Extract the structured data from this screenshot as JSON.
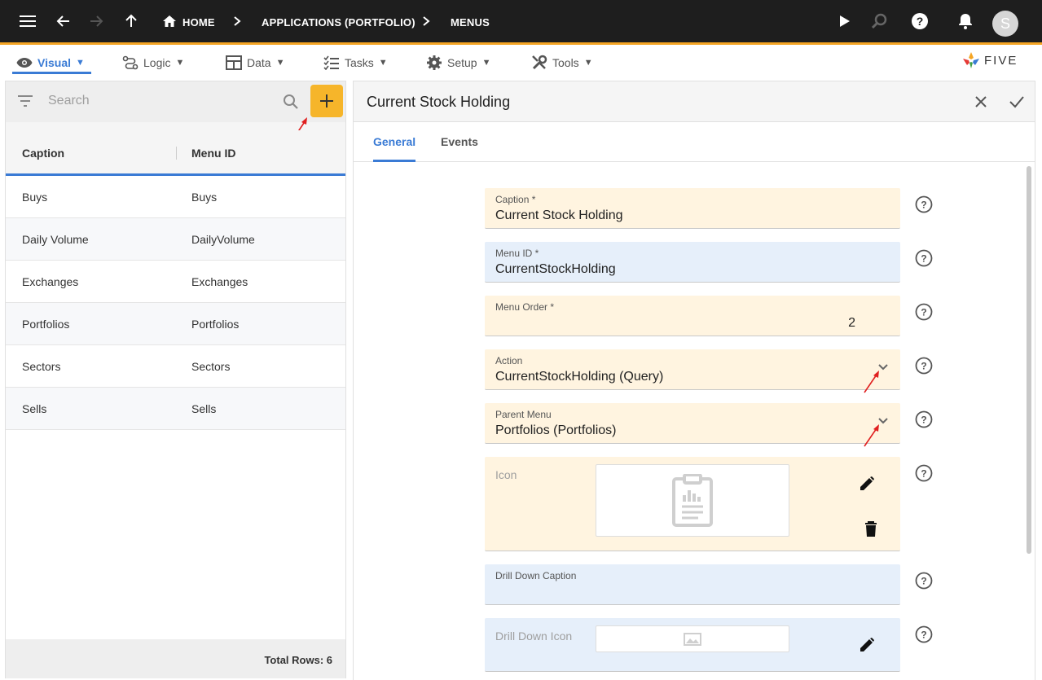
{
  "topbar": {
    "home": "HOME",
    "breadcrumb_app": "APPLICATIONS (PORTFOLIO)",
    "breadcrumb_menus": "MENUS",
    "avatar_letter": "S",
    "colors": {
      "bar": "#1e1e1e",
      "accent": "#f5a524"
    }
  },
  "menus": [
    {
      "label": "Visual",
      "icon": "eye-icon"
    },
    {
      "label": "Logic",
      "icon": "logic-icon"
    },
    {
      "label": "Data",
      "icon": "table-icon"
    },
    {
      "label": "Tasks",
      "icon": "tasks-icon"
    },
    {
      "label": "Setup",
      "icon": "gear-icon"
    },
    {
      "label": "Tools",
      "icon": "tools-icon"
    }
  ],
  "logo_text": "FIVE",
  "left": {
    "search_placeholder": "Search",
    "columns": [
      "Caption",
      "Menu ID"
    ],
    "rows": [
      {
        "caption": "Buys",
        "menu_id": "Buys"
      },
      {
        "caption": "Daily Volume",
        "menu_id": "DailyVolume"
      },
      {
        "caption": "Exchanges",
        "menu_id": "Exchanges"
      },
      {
        "caption": "Portfolios",
        "menu_id": "Portfolios"
      },
      {
        "caption": "Sectors",
        "menu_id": "Sectors"
      },
      {
        "caption": "Sells",
        "menu_id": "Sells"
      }
    ],
    "total_rows": "Total Rows: 6"
  },
  "form": {
    "title": "Current Stock Holding",
    "tabs": [
      "General",
      "Events"
    ],
    "caption": {
      "label": "Caption *",
      "value": "Current Stock Holding"
    },
    "menu_id": {
      "label": "Menu ID *",
      "value": "CurrentStockHolding"
    },
    "menu_order": {
      "label": "Menu Order *",
      "value": "2"
    },
    "action": {
      "label": "Action",
      "value": "CurrentStockHolding (Query)"
    },
    "parent_menu": {
      "label": "Parent Menu",
      "value": "Portfolios (Portfolios)"
    },
    "icon": {
      "label": "Icon"
    },
    "drill_down_caption": {
      "label": "Drill Down Caption",
      "value": ""
    },
    "drill_down_icon": {
      "label": "Drill Down Icon"
    }
  }
}
